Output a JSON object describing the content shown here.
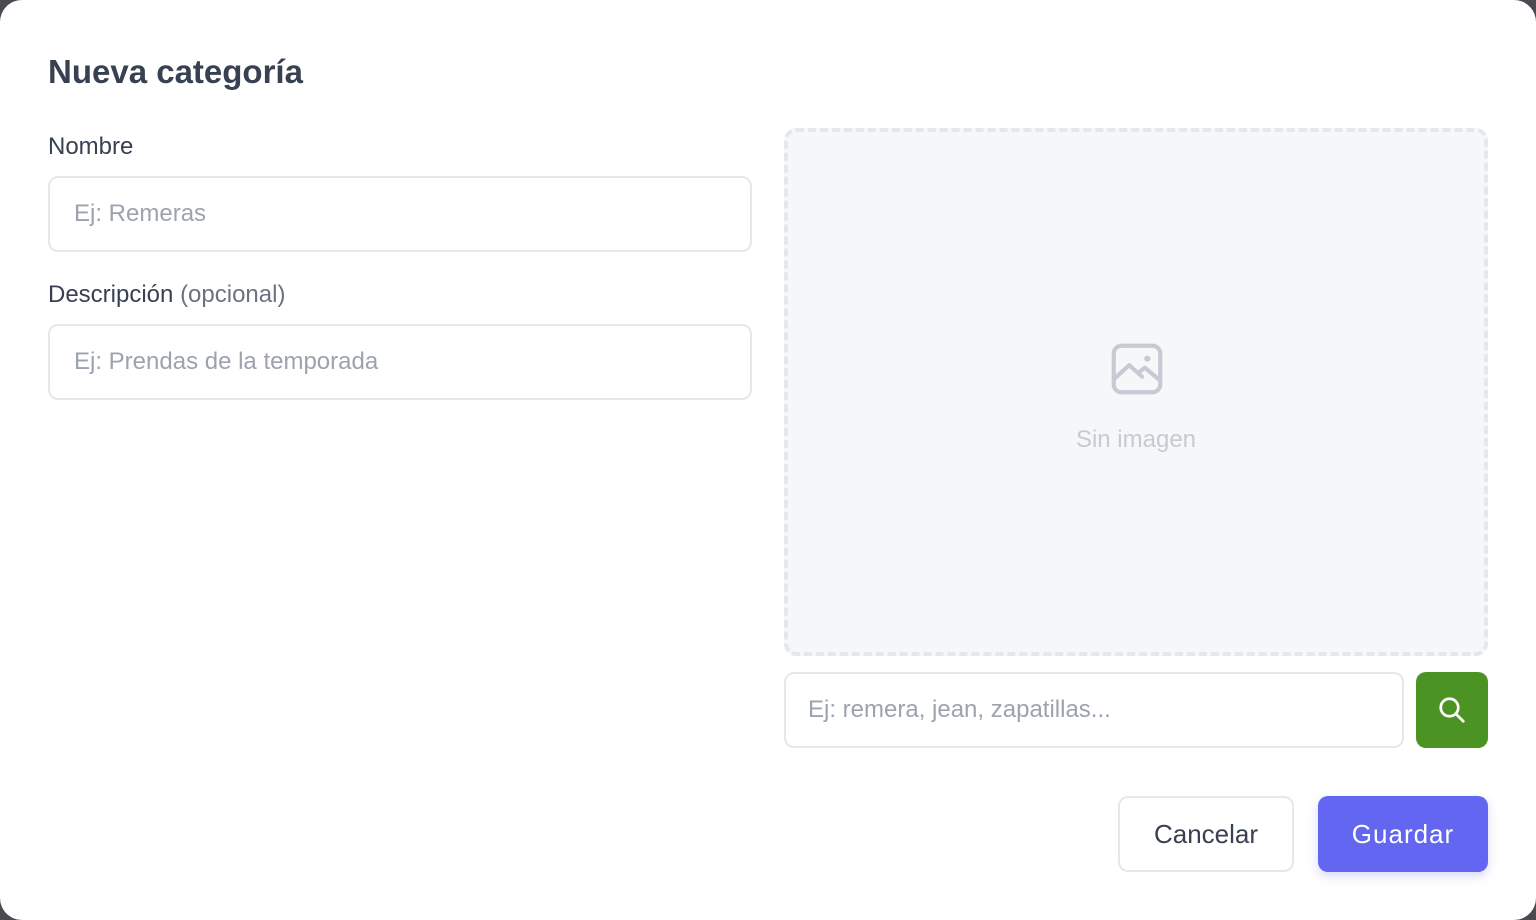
{
  "modal": {
    "title": "Nueva categoría"
  },
  "form": {
    "name_label": "Nombre",
    "name_placeholder": "Ej: Remeras",
    "name_value": "",
    "description_label": "Descripción",
    "description_optional": "(opcional)",
    "description_placeholder": "Ej: Prendas de la temporada",
    "description_value": ""
  },
  "image": {
    "icon": "image-placeholder-icon",
    "empty_text": "Sin imagen",
    "search_placeholder": "Ej: remera, jean, zapatillas...",
    "search_value": "",
    "search_icon": "search-icon"
  },
  "actions": {
    "cancel_label": "Cancelar",
    "save_label": "Guardar"
  },
  "colors": {
    "primary": "#6366f1",
    "search_button": "#4b9424",
    "text": "#374151",
    "placeholder": "#9ca3af",
    "border": "#e5e7eb"
  }
}
